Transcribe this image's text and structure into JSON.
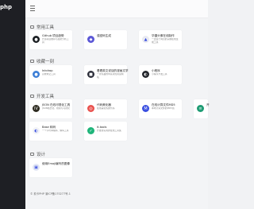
{
  "brand": {
    "logo_text": "php"
  },
  "sections": [
    {
      "title": "常用工具"
    },
    {
      "title": "收藏一刻"
    },
    {
      "title": "开发工具"
    },
    {
      "title": "设计"
    }
  ],
  "cards": {
    "common": [
      {
        "title": "Github 项目趋势",
        "desc": "开源项目推荐与趋势分析工具",
        "icon": "github-icon",
        "color": "#1b1f23",
        "glyph": "●"
      },
      {
        "title": "强密码生成",
        "desc": "",
        "icon": "shield-icon",
        "color": "#5b57d6",
        "glyph": "◆"
      },
      {
        "title": "华捷头像在线制作",
        "desc": "一款基于网页的头像在线生成工具",
        "icon": "avatar-icon",
        "color": "#e9eaf1",
        "glyph": "▲"
      }
    ],
    "collect": [
      {
        "title": "Inkdrop",
        "desc": "高效笔记工具",
        "icon": "inkdrop-icon",
        "color": "#3d7fd6",
        "glyph": "●"
      },
      {
        "title": "看看英文说话的漫画文学",
        "desc": "一款有趣的中英对照阅读网站",
        "icon": "comic-icon",
        "color": "#2a2c38",
        "glyph": "■"
      },
      {
        "title": "小程序",
        "desc": "小程序开发工具",
        "icon": "miniapp-icon",
        "color": "#22242a",
        "glyph": "◐"
      }
    ],
    "dev": [
      {
        "title": "JSON 在线可视化工具",
        "desc": "JSON格式化、校验与可视化",
        "icon": "json-icon",
        "color": "#2d2a1f",
        "glyph": "IV"
      },
      {
        "title": "代码美化器",
        "desc": "在线美化各类代码",
        "icon": "beautify-icon",
        "color": "#e9514d",
        "glyph": "◎"
      },
      {
        "title": "在线计算文件MD5",
        "desc": "本地计算文件的MD5值",
        "icon": "md5-icon",
        "color": "#3a4fe0",
        "glyph": "M"
      },
      {
        "title": "开",
        "desc": "",
        "icon": "dev-icon",
        "color": "#1f9c74",
        "glyph": "≡"
      },
      {
        "title": "Base 转码",
        "desc": "一个字符串编码、解码工具",
        "icon": "base-icon",
        "color": "#f2f3f7",
        "glyph": "◐"
      },
      {
        "title": "it-tools",
        "desc": "开发者实用的在线工具集",
        "icon": "ittools-icon",
        "color": "#1fb57a",
        "glyph": "✓"
      }
    ],
    "design": [
      {
        "title": "使用Emoji编写的图像",
        "desc": "",
        "icon": "emoji-icon",
        "color": "#e3e7f5",
        "glyph": "▣"
      }
    ]
  },
  "footer": {
    "text": "© 前卡PHP 渝ICP备170277号-1"
  }
}
